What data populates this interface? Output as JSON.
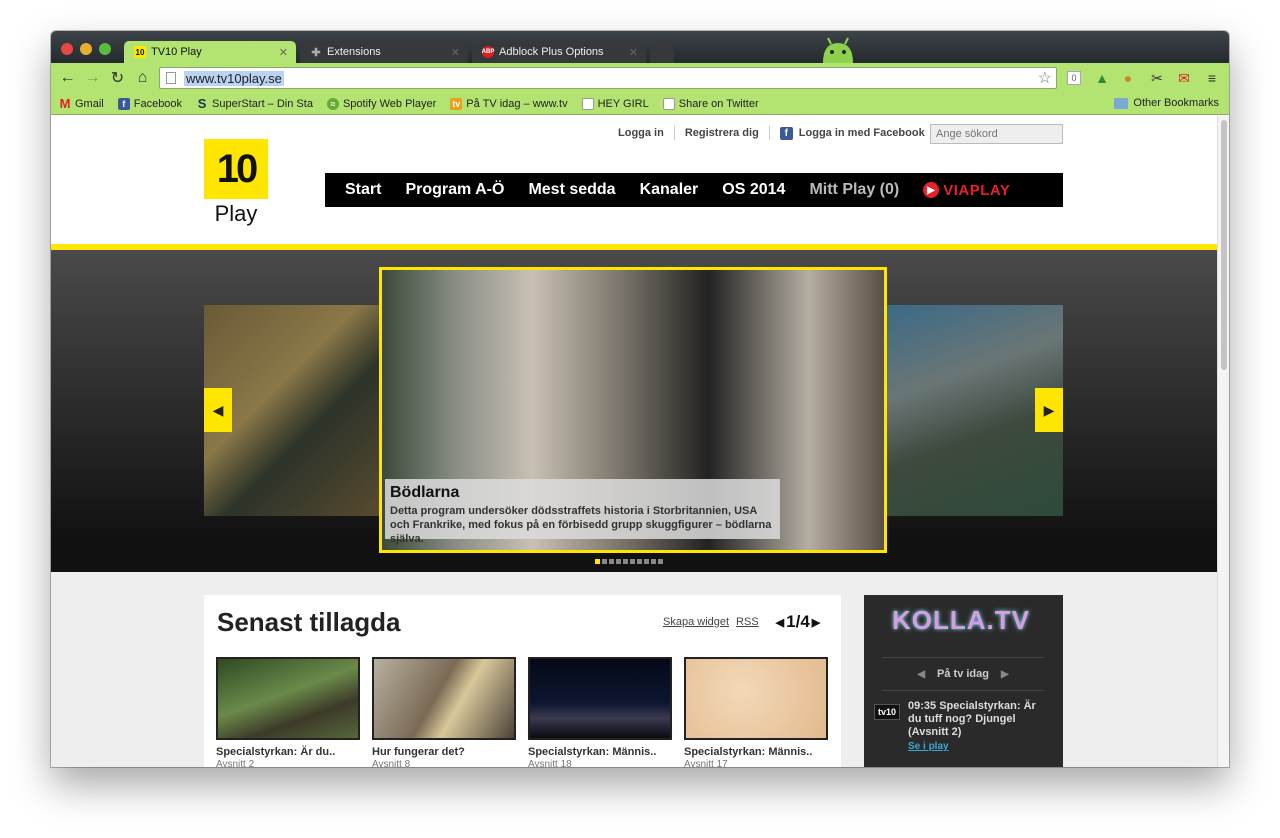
{
  "tabs": [
    {
      "label": "TV10 Play",
      "favicon": "10"
    },
    {
      "label": "Extensions",
      "favicon": "puzzle-icon"
    },
    {
      "label": "Adblock Plus Options",
      "favicon": "ABP"
    }
  ],
  "address": {
    "url": "www.tv10play.se",
    "badge": "0"
  },
  "bookmarks": [
    {
      "label": "Gmail",
      "icon": "gmail-icon"
    },
    {
      "label": "Facebook",
      "icon": "facebook-icon"
    },
    {
      "label": "SuperStart – Din Sta",
      "icon": "superstart-icon"
    },
    {
      "label": "Spotify Web Player",
      "icon": "spotify-icon"
    },
    {
      "label": "På TV idag – www.tv",
      "icon": "tv-icon"
    },
    {
      "label": "HEY GIRL",
      "icon": "page-icon"
    },
    {
      "label": "Share on Twitter",
      "icon": "page-icon"
    }
  ],
  "other_bookmarks": "Other Bookmarks",
  "site": {
    "toplinks": {
      "login": "Logga in",
      "register": "Registrera dig",
      "fb_login": "Logga in med Facebook"
    },
    "search_placeholder": "Ange sökord",
    "logo": {
      "number": "10",
      "word": "Play"
    },
    "nav": [
      "Start",
      "Program A-Ö",
      "Mest sedda",
      "Kanaler",
      "OS 2014",
      "Mitt Play (0)"
    ],
    "viaplay": "VIAPLAY",
    "hero": {
      "title": "Bödlarna",
      "description": "Detta program undersöker dödsstraffets historia i Storbritannien, USA och Frankrike, med fokus på en förbisedd grupp skuggfigurer – bödlarna själva."
    },
    "senast": {
      "heading": "Senast tillagda",
      "widget_link": "Skapa widget",
      "rss_link": "RSS",
      "pager": "1/4",
      "items": [
        {
          "title": "Specialstyrkan: Är du..",
          "sub": "Avsnitt 2"
        },
        {
          "title": "Hur fungerar det?",
          "sub": "Avsnitt 8"
        },
        {
          "title": "Specialstyrkan: Männis..",
          "sub": "Avsnitt 18"
        },
        {
          "title": "Specialstyrkan: Männis..",
          "sub": "Avsnitt 17"
        }
      ]
    },
    "sidebar": {
      "brand": "KOLLA.TV",
      "nav_label": "På tv idag",
      "channel": "tv10",
      "program": "09:35 Specialstyrkan: Är du tuff nog? Djungel (Avsnitt 2)",
      "watch_link": "Se i play"
    }
  },
  "colors": {
    "accent": "#ffe600",
    "browser_green": "#b3e472"
  }
}
